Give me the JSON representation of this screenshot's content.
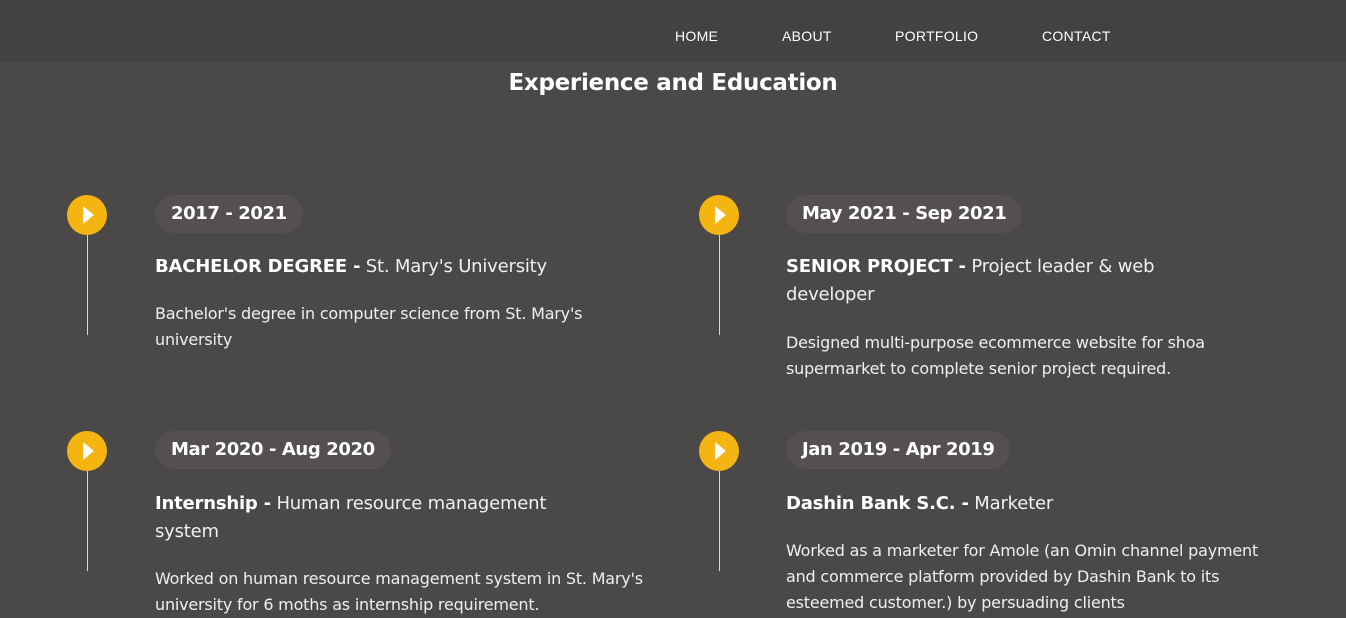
{
  "nav": {
    "home": "HOME",
    "about": "ABOUT",
    "portfolio": "PORTFOLIO",
    "contact": "CONTACT"
  },
  "section": {
    "title": "Experience and Education"
  },
  "timeline": [
    {
      "date": "2017 - 2021",
      "title": "BACHELOR DEGREE -",
      "subtitle": " St. Mary's University",
      "description": "Bachelor's degree in computer science from St. Mary's university"
    },
    {
      "date": "May 2021 - Sep 2021",
      "title": "SENIOR PROJECT -",
      "subtitle": " Project leader & web developer",
      "description": "Designed multi-purpose ecommerce website for shoa supermarket to complete senior project required."
    },
    {
      "date": "Mar 2020 - Aug 2020",
      "title": "Internship -",
      "subtitle": " Human resource management system",
      "description": "Worked on human resource management system in St. Mary's university for 6 moths as internship requirement."
    },
    {
      "date": "Jan 2019 - Apr 2019",
      "title": "Dashin Bank S.C. -",
      "subtitle": " Marketer",
      "description": "Worked as a marketer for Amole (an Omin channel payment and commerce platform provided by Dashin Bank to its esteemed customer.) by persuading clients"
    }
  ],
  "colors": {
    "background": "#4a4948",
    "navbar": "#434242",
    "accent": "#f4b513",
    "badge": "#555050"
  },
  "icons": {
    "marker": "play-arrow-icon"
  }
}
